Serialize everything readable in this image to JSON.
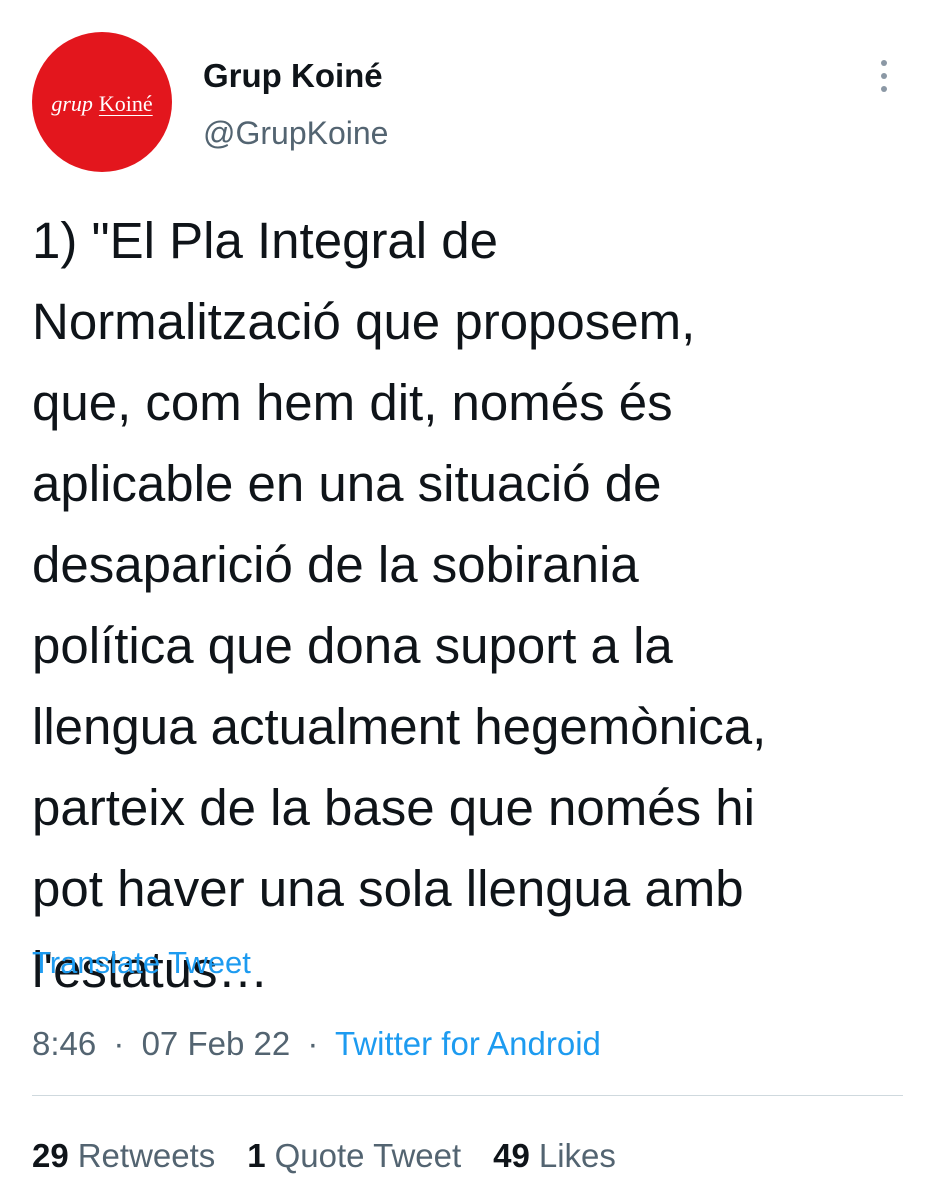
{
  "author": {
    "name": "Grup Koiné",
    "handle": "@GrupKoine",
    "avatar": {
      "logo_grup": "grup",
      "logo_koine": "Koiné",
      "bg_color": "#e3161d"
    }
  },
  "more_icon": "more-vertical-icon",
  "tweet": {
    "text": "1) \"El Pla Integral de\nNormalització que proposem,\nque, com hem dit, només és\naplicable en una situació de\ndesaparició de la sobirania\npolítica que dona suport a la\nllengua actualment hegemònica,\nparteix de la base que només hi\npot haver una sola llengua amb\nl'estatus…",
    "translate_label": "Translate Tweet",
    "time": "8:46",
    "date": "07 Feb 22",
    "separator": "·",
    "source": "Twitter for Android"
  },
  "stats": {
    "retweets_count": "29",
    "retweets_label": "Retweets",
    "quotes_count": "1",
    "quotes_label": "Quote Tweet",
    "likes_count": "49",
    "likes_label": "Likes"
  },
  "colors": {
    "link": "#1d9bf0",
    "secondary_text": "#536471",
    "primary_text": "#0f1419",
    "divider": "#cfd9de"
  }
}
